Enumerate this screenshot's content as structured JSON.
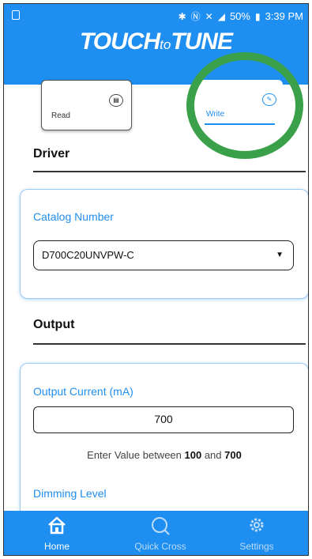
{
  "status_bar": {
    "battery": "50%",
    "time": "3:39 PM"
  },
  "header": {
    "logo_main_1": "TOUCH",
    "logo_small": "to",
    "logo_main_2": "TUNE"
  },
  "tabs": [
    {
      "label": "Read",
      "icon": "book-icon"
    },
    {
      "label": "Write",
      "icon": "edit-icon",
      "active": true
    }
  ],
  "driver": {
    "title": "Driver",
    "catalog_label": "Catalog Number",
    "catalog_value": "D700C20UNVPW-C"
  },
  "output": {
    "title": "Output",
    "current_label": "Output Current (mA)",
    "current_value": "700",
    "hint_prefix": "Enter Value between ",
    "hint_min": "100",
    "hint_and": " and ",
    "hint_max": "700",
    "dimming_label": "Dimming Level"
  },
  "nav": [
    {
      "label": "Home",
      "icon": "home-icon",
      "active": true
    },
    {
      "label": "Quick Cross",
      "icon": "search-icon"
    },
    {
      "label": "Settings",
      "icon": "gear-icon"
    }
  ],
  "colors": {
    "primary": "#1f8ef1",
    "highlight_ring": "#3aa14a"
  }
}
